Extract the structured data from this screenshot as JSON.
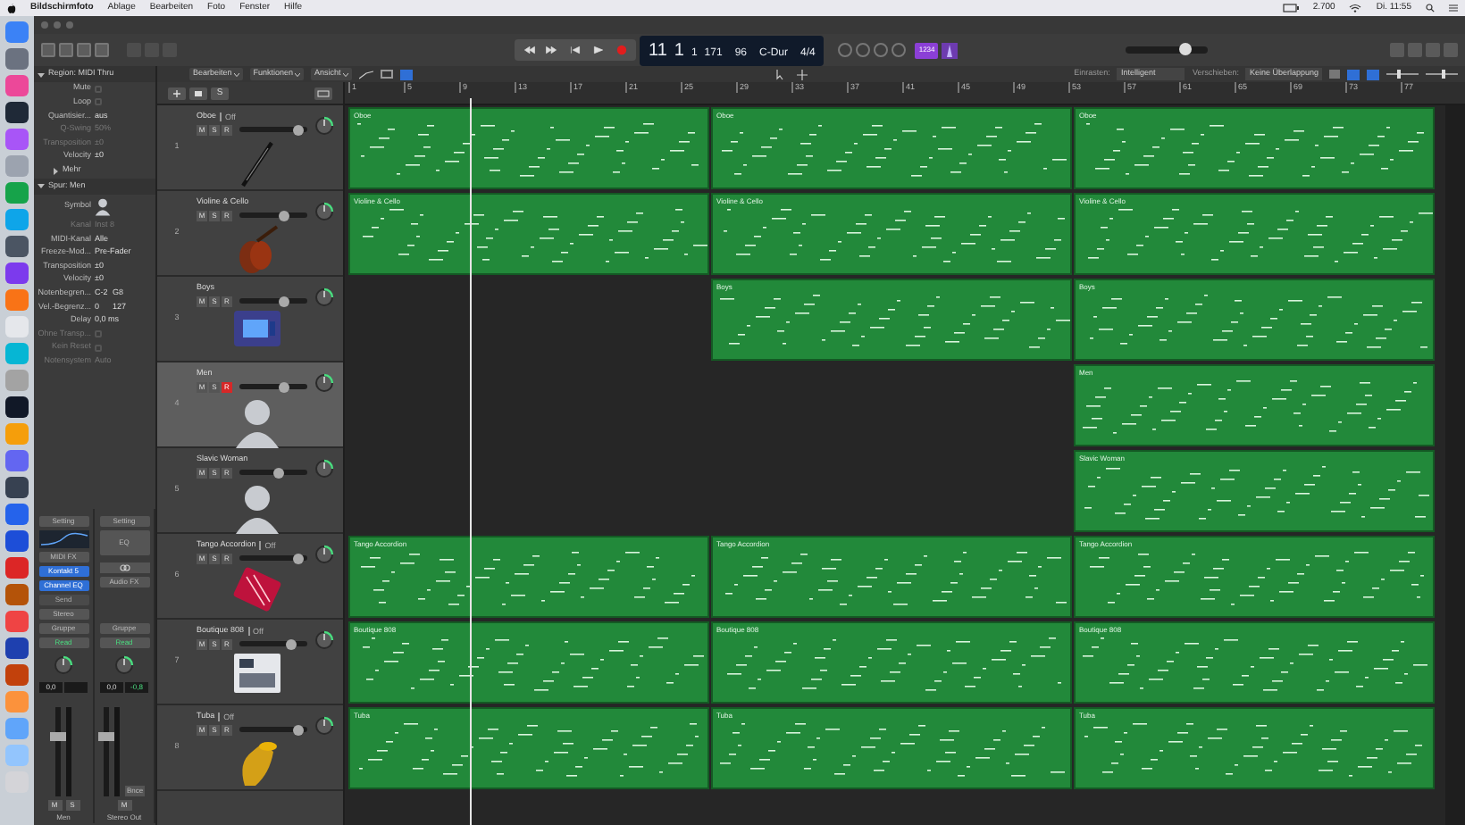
{
  "menu_bar": {
    "app": "Bildschirmfoto",
    "items": [
      "Ablage",
      "Bearbeiten",
      "Foto",
      "Fenster",
      "Hilfe"
    ],
    "status": [
      "2.700",
      "Di. 11:55"
    ]
  },
  "control_bar": {
    "lcd": {
      "bar": "11",
      "beat": "1",
      "division": "1",
      "tick": "171",
      "tempo": "96",
      "key": "C-Dur",
      "signature": "4/4"
    },
    "count_in": {
      "label": "1234",
      "on": true
    },
    "master_volume": {
      "level": 0.75
    }
  },
  "toolbar": {
    "menus": [
      "Bearbeiten",
      "Funktionen",
      "Ansicht"
    ],
    "snap_label": "Einrasten:",
    "snap_value": "Intelligent",
    "drag_label": "Verschieben:",
    "drag_value": "Keine Überlappung",
    "zoom_sliders": [
      {
        "level": 0.4
      },
      {
        "level": 0.55
      }
    ]
  },
  "inspector": {
    "region": {
      "title": "Region: MIDI Thru",
      "expanded": true,
      "rows": [
        {
          "kind": "checkbox",
          "label": "Mute",
          "checked": false,
          "dim": false
        },
        {
          "kind": "checkbox",
          "label": "Loop",
          "checked": false,
          "dim": false
        },
        {
          "kind": "value",
          "label": "Quantisier...",
          "value": "aus",
          "dim": false
        },
        {
          "kind": "value",
          "label": "Q-Swing",
          "value": "50%",
          "dim": true
        },
        {
          "kind": "value",
          "label": "Transposition",
          "value": "±0",
          "dim": true
        },
        {
          "kind": "value",
          "label": "Velocity",
          "value": "±0",
          "dim": false
        }
      ]
    },
    "more": {
      "label": "Mehr",
      "expanded": false
    },
    "track": {
      "title": "Spur: Men",
      "expanded": true,
      "rows": [
        {
          "kind": "symbol",
          "label": "Symbol",
          "dim": false
        },
        {
          "kind": "value",
          "label": "Kanal",
          "value": "Inst 8",
          "dim": true
        },
        {
          "kind": "value",
          "label": "MIDI-Kanal",
          "value": "Alle",
          "dim": false
        },
        {
          "kind": "value",
          "label": "Freeze-Mod...",
          "value": "Pre-Fader",
          "dim": false
        },
        {
          "kind": "value",
          "label": "Transposition",
          "value": "±0",
          "dim": false
        },
        {
          "kind": "value",
          "label": "Velocity",
          "value": "±0",
          "dim": false
        },
        {
          "kind": "pair",
          "label": "Notenbegren...",
          "value": "C-2",
          "value2": "G8",
          "dim": false
        },
        {
          "kind": "pair",
          "label": "Vel.-Begrenz...",
          "value": "0",
          "value2": "127",
          "dim": false
        },
        {
          "kind": "value",
          "label": "Delay",
          "value": "0,0 ms",
          "dim": false
        },
        {
          "kind": "checkbox",
          "label": "Ohne Transp...",
          "checked": false,
          "dim": true
        },
        {
          "kind": "checkbox",
          "label": "Kein Reset",
          "checked": false,
          "dim": true
        },
        {
          "kind": "value",
          "label": "Notensystem",
          "value": "Auto",
          "dim": true
        }
      ]
    }
  },
  "channel_strips": [
    {
      "name": "Men",
      "items": [
        {
          "kind": "button",
          "label": "Setting"
        },
        {
          "kind": "eq-graph"
        },
        {
          "kind": "button",
          "label": "MIDI FX"
        },
        {
          "kind": "plugin",
          "label": "Kontakt 5"
        },
        {
          "kind": "plugin",
          "label": "Channel EQ"
        },
        {
          "kind": "send",
          "label": "Send"
        },
        {
          "kind": "button",
          "label": "Stereo"
        },
        {
          "kind": "button",
          "label": "Gruppe"
        },
        {
          "kind": "automation",
          "label": "Read"
        },
        {
          "kind": "knob"
        },
        {
          "kind": "readouts",
          "values": [
            "0,0"
          ]
        },
        {
          "kind": "fader",
          "level": 0.7
        },
        {
          "kind": "buttons",
          "labels": [
            "M",
            "S"
          ]
        }
      ]
    },
    {
      "name": "Stereo Out",
      "items": [
        {
          "kind": "button",
          "label": "Setting"
        },
        {
          "kind": "tall-button",
          "label": "EQ"
        },
        {
          "kind": "link"
        },
        {
          "kind": "button",
          "label": "Audio FX"
        },
        {
          "kind": "gap"
        },
        {
          "kind": "button",
          "label": "Gruppe"
        },
        {
          "kind": "automation",
          "label": "Read"
        },
        {
          "kind": "knob"
        },
        {
          "kind": "readouts",
          "values": [
            "0,0",
            "-0,8"
          ]
        },
        {
          "kind": "fader",
          "level": 0.7,
          "label": "Bnce"
        },
        {
          "kind": "buttons",
          "labels": [
            "M"
          ]
        }
      ]
    }
  ],
  "track_list": {
    "solo_label": "S",
    "ruler": [
      "1",
      "5",
      "9",
      "13",
      "17",
      "21",
      "25",
      "29",
      "33",
      "37",
      "41",
      "45",
      "49",
      "53",
      "57",
      "61",
      "65",
      "69",
      "73",
      "77"
    ]
  },
  "tracks": [
    {
      "number": "1",
      "buttons": [
        "M",
        "S",
        "R"
      ],
      "name": "Oboe",
      "suffix": "Off",
      "selected": false,
      "record_armed": false,
      "level": 0.95,
      "regions": [
        {
          "kind": "region",
          "label": "Oboe"
        },
        {
          "kind": "region",
          "label": "Oboe"
        },
        {
          "kind": "region",
          "label": "Oboe"
        }
      ]
    },
    {
      "number": "2",
      "buttons": [
        "M",
        "S",
        "R"
      ],
      "name": "Violine & Cello",
      "selected": false,
      "record_armed": false,
      "level": 0.7,
      "regions": [
        {
          "kind": "region",
          "label": "Violine & Cello"
        },
        {
          "kind": "region",
          "label": "Violine & Cello"
        },
        {
          "kind": "region",
          "label": "Violine & Cello"
        }
      ]
    },
    {
      "number": "3",
      "buttons": [
        "M",
        "S",
        "R"
      ],
      "name": "Boys",
      "selected": false,
      "record_armed": false,
      "level": 0.7,
      "regions": [
        {
          "kind": "empty"
        },
        {
          "kind": "region",
          "label": "Boys"
        },
        {
          "kind": "region",
          "label": "Boys"
        }
      ]
    },
    {
      "number": "4",
      "buttons": [
        "M",
        "S",
        "R"
      ],
      "name": "Men",
      "selected": true,
      "record_armed": true,
      "level": 0.7,
      "regions": [
        {
          "kind": "empty"
        },
        {
          "kind": "empty"
        },
        {
          "kind": "region",
          "label": "Men"
        }
      ]
    },
    {
      "number": "5",
      "buttons": [
        "M",
        "S",
        "R"
      ],
      "name": "Slavic Woman",
      "selected": false,
      "record_armed": false,
      "level": 0.6,
      "regions": [
        {
          "kind": "empty"
        },
        {
          "kind": "empty"
        },
        {
          "kind": "region",
          "label": "Slavic Woman"
        }
      ]
    },
    {
      "number": "6",
      "buttons": [
        "M",
        "S",
        "R"
      ],
      "name": "Tango Accordion",
      "suffix": "Off",
      "selected": false,
      "record_armed": false,
      "level": 0.95,
      "regions": [
        {
          "kind": "region",
          "label": "Tango Accordion"
        },
        {
          "kind": "region",
          "label": "Tango Accordion"
        },
        {
          "kind": "region",
          "label": "Tango Accordion"
        }
      ]
    },
    {
      "number": "7",
      "buttons": [
        "M",
        "S",
        "R"
      ],
      "name": "Boutique 808",
      "suffix": "Off",
      "selected": false,
      "record_armed": false,
      "level": 0.8,
      "regions": [
        {
          "kind": "region",
          "label": "Boutique 808"
        },
        {
          "kind": "region",
          "label": "Boutique 808"
        },
        {
          "kind": "region",
          "label": "Boutique 808"
        }
      ]
    },
    {
      "number": "8",
      "buttons": [
        "M",
        "S",
        "R"
      ],
      "name": "Tuba",
      "suffix": "Off",
      "selected": false,
      "record_armed": false,
      "level": 0.95,
      "regions": [
        {
          "kind": "region",
          "label": "Tuba"
        },
        {
          "kind": "region",
          "label": "Tuba"
        },
        {
          "kind": "region",
          "label": "Tuba"
        }
      ]
    }
  ]
}
